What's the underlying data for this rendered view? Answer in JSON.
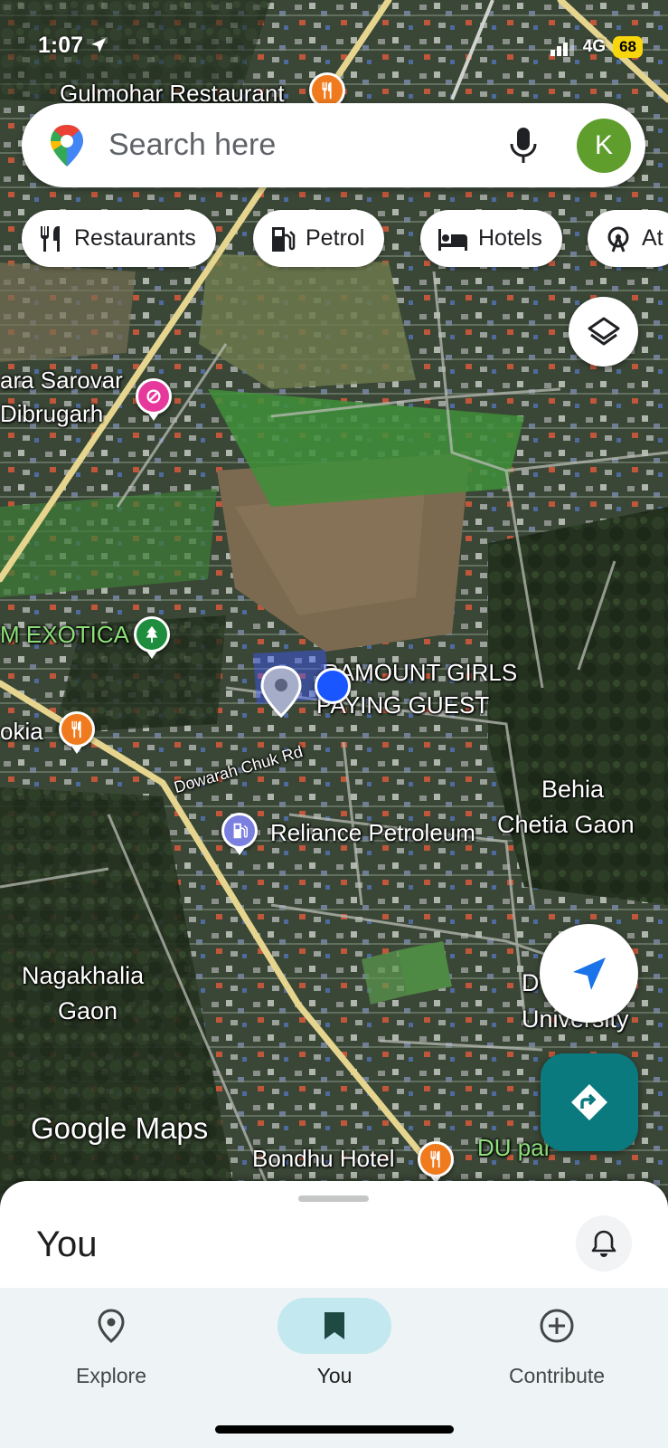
{
  "status_bar": {
    "time": "1:07",
    "network": "4G",
    "battery": "68"
  },
  "search": {
    "placeholder": "Search here",
    "avatar_initial": "K"
  },
  "chips": [
    {
      "label": "Restaurants",
      "icon": "fork-knife-icon"
    },
    {
      "label": "Petrol",
      "icon": "fuel-pump-icon"
    },
    {
      "label": "Hotels",
      "icon": "bed-icon"
    },
    {
      "label": "At",
      "icon": "ferris-wheel-icon"
    }
  ],
  "map": {
    "labels": {
      "gulmohar": "Gulmohar Restaurant",
      "sarovar_1": "ara Sarovar",
      "sarovar_2": "Dibrugarh",
      "exotica": "M EXOTICA",
      "okia": "okia",
      "paramount_1": "RAMOUNT GIRLS",
      "paramount_2": "PAYING GUEST",
      "road": "Dowarah Chuk Rd",
      "reliance": "Reliance Petroleum",
      "behia_1": "Behia",
      "behia_2": "Chetia Gaon",
      "nagakhalia_1": "Nagakhalia",
      "nagakhalia_2": "Gaon",
      "univ_1": "D        rh",
      "univ_2": "University",
      "bondhu": "Bondhu Hotel",
      "du_park": "DU par"
    },
    "watermark": "Google Maps",
    "colors": {
      "restaurant_pin": "#f07b1f",
      "hotel_pin": "#e7399c",
      "park_pin": "#1e8e3e",
      "fuel_pin": "#7b7fe0",
      "location_dot": "#1a73e8"
    }
  },
  "buttons": {
    "layers": "layers-icon",
    "locate": "navigation-arrow-icon",
    "directions": "directions-icon"
  },
  "sheet": {
    "title": "You"
  },
  "nav": [
    {
      "label": "Explore",
      "icon": "location-pin-icon",
      "active": false
    },
    {
      "label": "You",
      "icon": "bookmark-icon",
      "active": true
    },
    {
      "label": "Contribute",
      "icon": "add-circle-icon",
      "active": false
    }
  ]
}
